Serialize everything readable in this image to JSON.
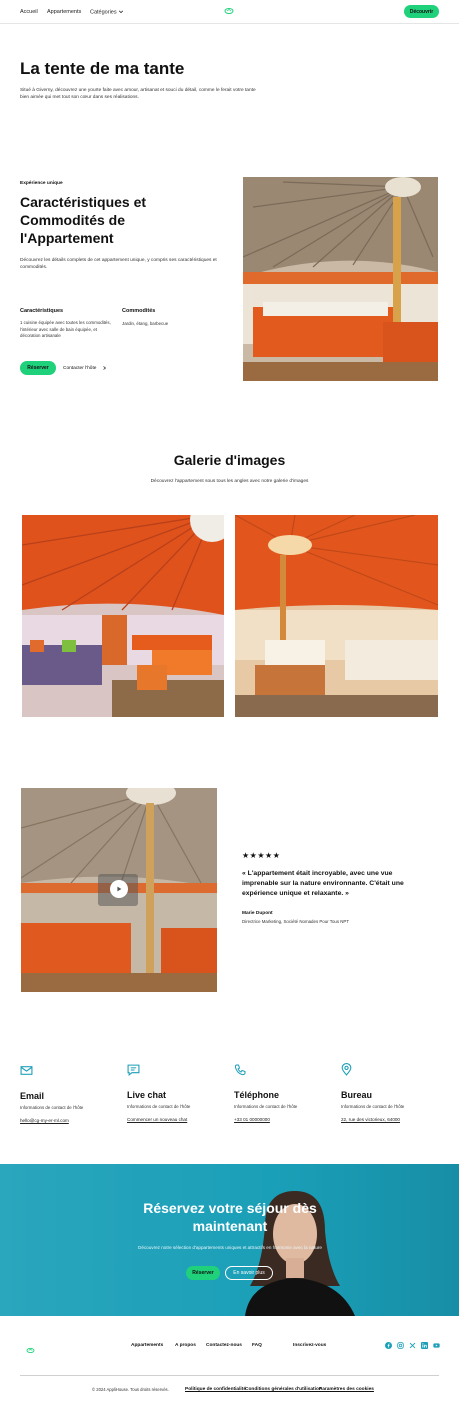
{
  "nav": {
    "home": "Accueil",
    "apartments": "Appartements",
    "categories": "Catégories",
    "cta": "Découvrir"
  },
  "hero": {
    "title": "La tente de ma tante",
    "description": "Situé à Giverny, découvrez une yourte faite avec amour, artisanat et souci du détail, comme le ferait votre tante bien aimée qui met tout son cœur dans ses réalisations."
  },
  "features": {
    "tagline": "Expérience unique",
    "title": "Caractéristiques et Commodités de l'Appartement",
    "description": "Découvrez les détails complets de cet appartement unique, y compris ses caractéristiques et commodités.",
    "col1_title": "Caractéristiques",
    "col1_text": "1 cuisine équipée avec toutes les commodités, l'intérieur avec salle de bain équipée, et décoration artisanale",
    "col2_title": "Commodités",
    "col2_text": "Jardin, étang, barbecue",
    "book_button": "Réserver",
    "contact_link": "Contacter l'hôte"
  },
  "gallery": {
    "title": "Galerie d'images",
    "subtitle": "Découvrez l'appartement sous tous les angles avec notre galerie d'images"
  },
  "testimonial": {
    "stars": "★★★★★",
    "quote": "« L'appartement était incroyable, avec une vue imprenable sur la nature environnante. C'était une expérience unique et relaxante. »",
    "author": "Marie Dupont",
    "role": "Directrice Marketing, Société Nomades Pour Tous NPT"
  },
  "contact": [
    {
      "icon": "mail-icon",
      "title": "Email",
      "text": "Informations de contact de l'hôte",
      "link": "hello@cg-my-er-ml.com"
    },
    {
      "icon": "chat-icon",
      "title": "Live chat",
      "text": "Informations de contact de l'hôte",
      "link": "Commencer un nouveau chat"
    },
    {
      "icon": "phone-icon",
      "title": "Téléphone",
      "text": "Informations de contact de l'hôte",
      "link": "+33 01 00000000"
    },
    {
      "icon": "pin-icon",
      "title": "Bureau",
      "text": "Informations de contact de l'hôte",
      "link": "22, rue des victorieux, 64000"
    }
  ],
  "cta": {
    "title": "Réservez votre séjour dès maintenant",
    "subtitle": "Découvrez notre sélection d'appartements uniques et attractifs en harmonie avec la nature",
    "book": "Réserver",
    "more": "En savoir plus"
  },
  "footer": {
    "links": [
      "Appartements",
      "A propos",
      "Contactez-nous",
      "FAQ"
    ],
    "subscribe": "Inscrivez-vous",
    "copyright": "© 2024 AppliHouse. Tous droits réservés.",
    "privacy": "Politique de confidentialité",
    "terms": "Conditions générales d'utilisation",
    "cookies": "Paramètres des cookies"
  },
  "colors": {
    "accent": "#1fd17a",
    "banner": "#1d9db5",
    "icon": "#1a9fb8"
  }
}
